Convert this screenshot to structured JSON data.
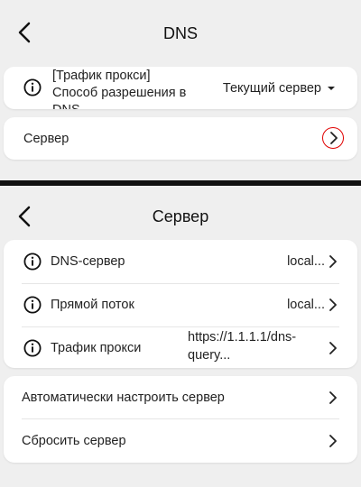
{
  "dns_screen": {
    "title": "DNS",
    "proxy_resolution": {
      "label_line1": "[Трафик прокси]",
      "label_line2": "Способ разрешения в",
      "label_line3": "DNS",
      "value": "Текущий сервер"
    },
    "server_row": {
      "label": "Сервер"
    }
  },
  "server_screen": {
    "title": "Сервер",
    "rows": [
      {
        "label": "DNS-сервер",
        "value": "local..."
      },
      {
        "label": "Прямой поток",
        "value": "local..."
      },
      {
        "label": "Трафик прокси",
        "value_line1": "https://1.1.1.1/dns-",
        "value_line2": "query..."
      }
    ],
    "actions": [
      {
        "label": "Автоматически настроить сервер"
      },
      {
        "label": "Сбросить сервер"
      }
    ]
  },
  "colors": {
    "highlight": "#e00000",
    "background": "#efefef",
    "card": "#ffffff"
  }
}
